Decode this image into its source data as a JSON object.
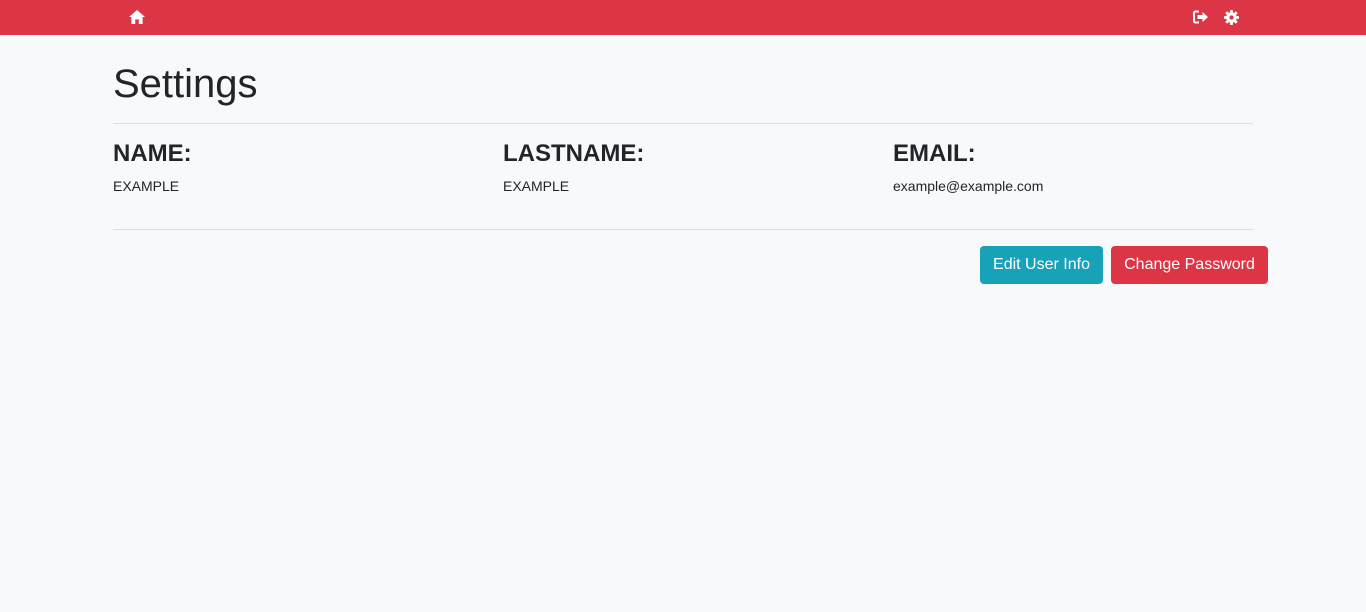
{
  "colors": {
    "navbar": "#dc3545",
    "edit_button": "#17a2b8",
    "password_button": "#dc3545",
    "background": "#f8f9fa"
  },
  "navbar": {
    "icons": {
      "home": "home-icon",
      "logout": "sign-out-icon",
      "settings": "gear-icon"
    }
  },
  "page": {
    "title": "Settings"
  },
  "user_info": {
    "name_label": "NAME:",
    "name_value": "EXAMPLE",
    "lastname_label": "LASTNAME:",
    "lastname_value": "EXAMPLE",
    "email_label": "EMAIL:",
    "email_value": "example@example.com"
  },
  "actions": {
    "edit_label": "Edit User Info",
    "change_password_label": "Change Password"
  }
}
